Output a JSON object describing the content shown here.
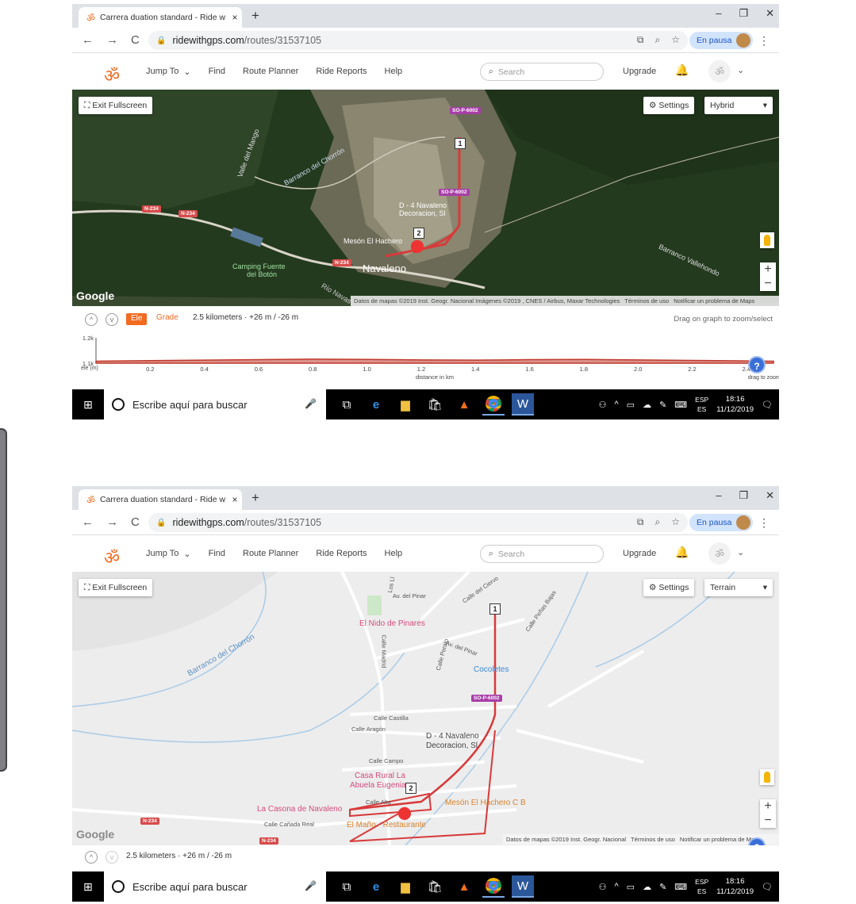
{
  "browser": {
    "tab_title": "Carrera duation standard - Ride w",
    "tab_close": "×",
    "new_tab": "+",
    "win_min": "–",
    "win_max": "❐",
    "win_close": "✕",
    "back": "←",
    "forward": "→",
    "reload": "C",
    "url_host": "ridewithgps.com",
    "url_path": "/routes/31537105",
    "pause_label": "En pausa",
    "kebab": "⋮"
  },
  "site": {
    "logo": "ॐ",
    "menu": [
      "Jump To",
      "Find",
      "Route Planner",
      "Ride Reports",
      "Help"
    ],
    "search_placeholder": "Search",
    "upgrade": "Upgrade"
  },
  "top_map": {
    "mode": "Hybrid",
    "exit_fullscreen": "Exit Fullscreen",
    "settings": "Settings",
    "google": "Google",
    "attribution": [
      "Datos de mapas ©2019 Inst. Geogr. Nacional Imágenes ©2019 , CNES / Airbus, Maxar Technologies",
      "Términos de uso",
      "Notificar un problema de Maps"
    ],
    "labels": {
      "valle": "Valle del Mango",
      "barranco": "Barranco del Chorrón",
      "decoracion1": "D - 4 Navaleno",
      "decoracion2": "Decoracion, Sl",
      "meson": "Mesón El Hachero",
      "camping1": "Camping Fuente",
      "camping2": "del Botón",
      "navaleno": "Navaleno",
      "rio": "Río Navas",
      "vallehondo": "Barranco Vallehondo"
    },
    "roads": {
      "so1": "SO-P-6002",
      "so2": "SO-P-6002",
      "n1": "N-234",
      "n2": "N-234",
      "n3": "N-234"
    },
    "markers": [
      "1",
      "2"
    ]
  },
  "elevation": {
    "ele_tab": "Ele",
    "grade_tab": "Grade",
    "summary": "2.5 kilometers · +26 m / -26 m",
    "hint": "Drag on graph to zoom/select",
    "ylabel": "ele\n(m)",
    "xlabel": "distance in km",
    "zoom_hint": "drag to zoom in",
    "help": "?"
  },
  "chart_data": {
    "type": "area",
    "title": "",
    "xlabel": "distance in km",
    "ylabel": "ele (m)",
    "y_ticks": [
      "1.2k",
      "1.1k"
    ],
    "ylim": [
      1100,
      1200
    ],
    "xlim": [
      0,
      2.5
    ],
    "x_ticks": [
      "0.2",
      "0.4",
      "0.6",
      "0.8",
      "1.0",
      "1.2",
      "1.4",
      "1.6",
      "1.8",
      "2.0",
      "2.2",
      "2.4"
    ],
    "x": [
      0,
      0.2,
      0.4,
      0.6,
      0.8,
      1.0,
      1.2,
      1.4,
      1.6,
      1.8,
      2.0,
      2.2,
      2.4,
      2.5
    ],
    "y": [
      1108,
      1110,
      1112,
      1114,
      1116,
      1115,
      1113,
      1112,
      1114,
      1115,
      1113,
      1111,
      1109,
      1108
    ],
    "color": "#c0392b"
  },
  "bottom_map": {
    "mode": "Terrain",
    "exit_fullscreen": "Exit Fullscreen",
    "settings": "Settings",
    "google": "Google",
    "attribution": [
      "Datos de mapas ©2019 Inst. Geogr. Nacional",
      "Términos de uso",
      "Notificar un problema de Maps"
    ],
    "summary": "2.5 kilometers · +26 m / -26 m",
    "labels": {
      "ciervo": "Calle del Ciervo",
      "pinar": "Av. del Pinar",
      "pinar2": "Av. del Pinar",
      "los": "Los Ll",
      "nido": "El Nido de Pinares",
      "madrid": "Calle Madrid",
      "peralo": "Calle Peralo",
      "penas": "Calle Peñas Bajas",
      "chorron": "Barranco del Chorrón",
      "cocoletes": "Cocoletes",
      "castilla": "Calle Castilla",
      "aragon": "Calle Aragón",
      "deco1": "D - 4 Navaleno",
      "deco2": "Decoracion, Sl",
      "campo": "Calle Campo",
      "casa1": "Casa Rural La",
      "casa2": "Abuela Eugenia",
      "casona": "La Casona de Navaleno",
      "alta": "Calle Alta",
      "meson": "Mesón El Hachero C B",
      "canada": "Calle Cañada Real",
      "mano": "El Maño - Restaurante"
    },
    "roads": {
      "so": "SO-P-6002",
      "n1": "N-234",
      "n2": "N-234"
    },
    "markers": [
      "1",
      "2"
    ]
  },
  "taskbar": {
    "search": "Escribe aquí para buscar",
    "lang1": "ESP",
    "lang2": "ES",
    "time": "18:16",
    "date": "11/12/2019"
  },
  "colors": {
    "accent": "#f26b21",
    "route": "#d83a3a",
    "taskbar": "#000000"
  }
}
